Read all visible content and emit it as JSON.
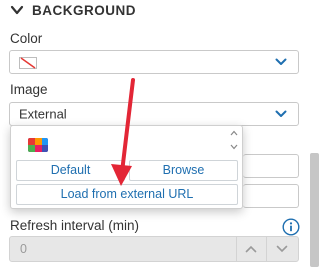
{
  "section": {
    "title": "BACKGROUND",
    "icon": "chevron-down-icon"
  },
  "color": {
    "label": "Color",
    "value_icon": "no-color-swatch-icon"
  },
  "image": {
    "label": "Image",
    "value": "External"
  },
  "popup": {
    "default_label": "Default",
    "browse_label": "Browse",
    "external_label": "Load from external URL"
  },
  "hidden_label_fragment": "U",
  "refresh": {
    "label": "Refresh interval (min)",
    "value": "0",
    "info_icon": "info-icon"
  },
  "colors": {
    "accent": "#1f6fb0",
    "arrow": "#e32636"
  }
}
